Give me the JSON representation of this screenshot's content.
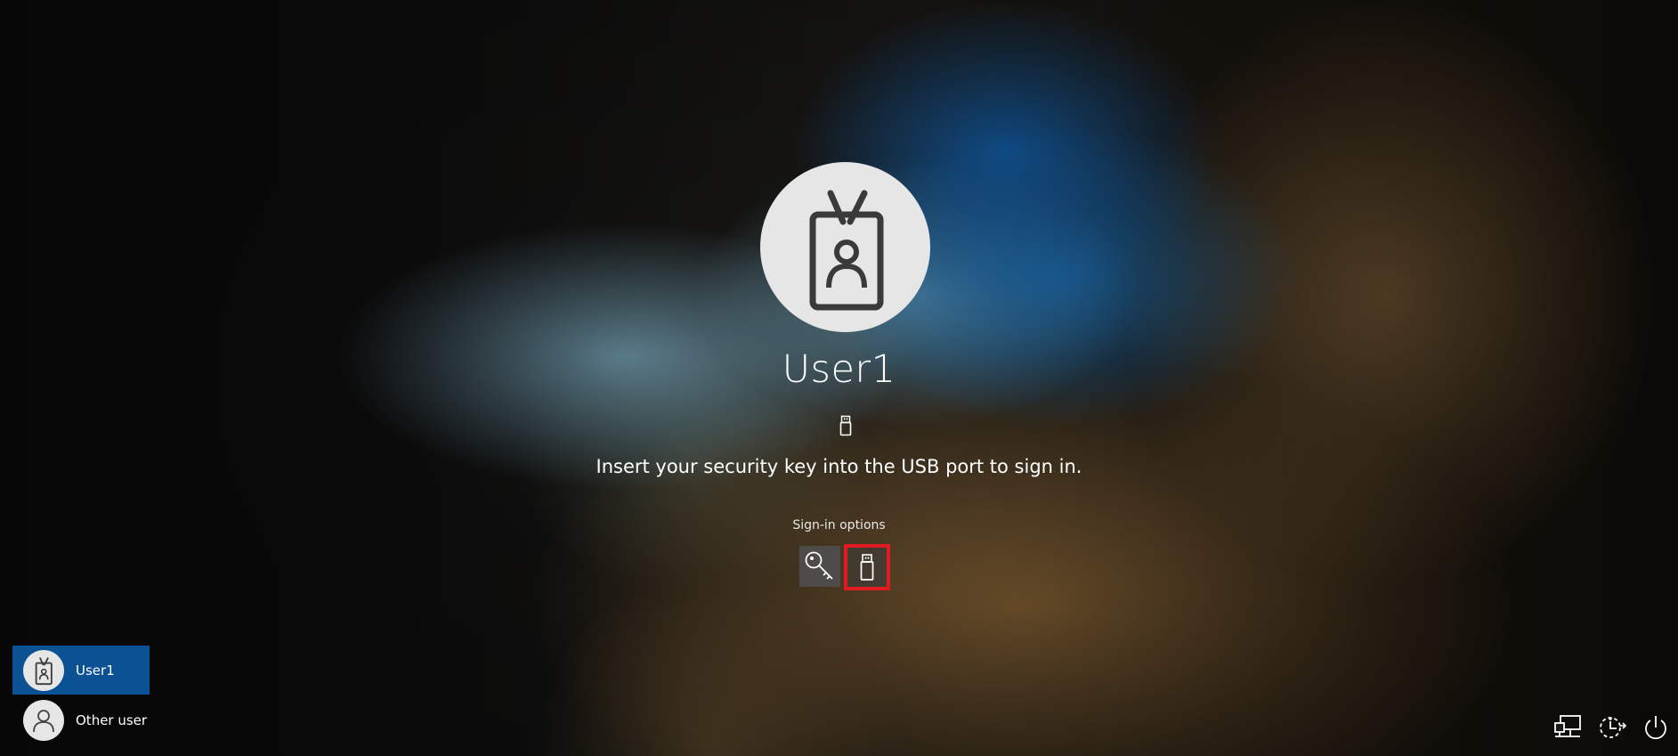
{
  "user": {
    "name": "User1",
    "avatar_icon": "id-badge-icon"
  },
  "prompt": {
    "instruction": "Insert your security key into the USB port to sign in.",
    "hint_icon": "usb-key-icon"
  },
  "signin_options": {
    "label": "Sign-in options",
    "options": [
      {
        "id": "password",
        "icon": "key-icon",
        "selected": false
      },
      {
        "id": "security-key",
        "icon": "usb-key-icon",
        "selected": true
      }
    ],
    "selected_highlight_color": "#e21a22"
  },
  "user_list": [
    {
      "name": "User1",
      "icon": "id-badge-icon",
      "selected": true
    },
    {
      "name": "Other user",
      "icon": "person-icon",
      "selected": false
    }
  ],
  "system_tray": [
    {
      "id": "network",
      "icon": "network-icon"
    },
    {
      "id": "ease-of-access",
      "icon": "ease-of-access-icon"
    },
    {
      "id": "power",
      "icon": "power-icon"
    }
  ],
  "colors": {
    "selected_user_bg": "#0a5294",
    "avatar_bg": "#e6e6e6"
  }
}
